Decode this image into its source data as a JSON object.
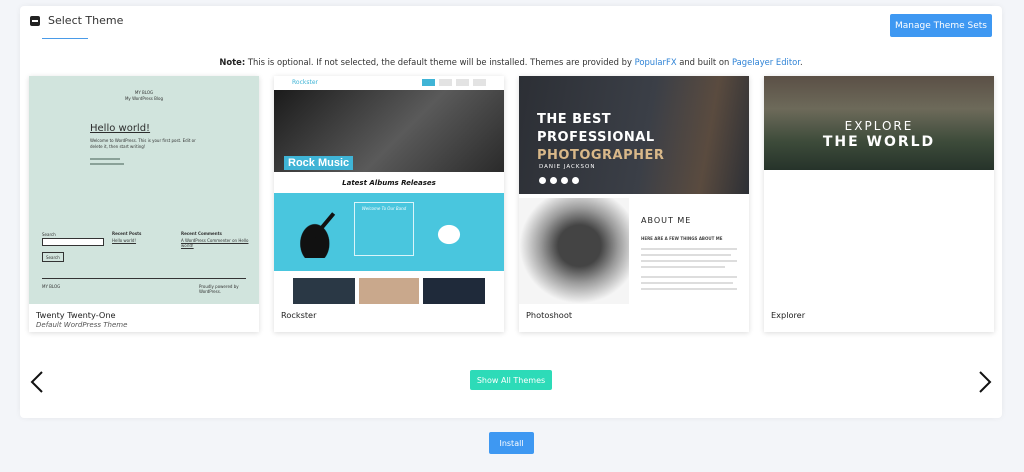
{
  "header": {
    "title": "Select Theme",
    "manage_label": "Manage Theme Sets"
  },
  "note": {
    "label": "Note:",
    "text_before": " This is optional. If not selected, the default theme will be installed. Themes are provided by ",
    "link1": "PopularFX",
    "text_middle": " and built on ",
    "link2": "Pagelayer Editor",
    "text_after": "."
  },
  "themes": [
    {
      "name": "Twenty Twenty-One",
      "subtitle": "Default WordPress Theme",
      "preview": {
        "site_title": "MY BLOG",
        "tagline": "My WordPress Blog",
        "post_title": "Hello world!",
        "post_text": "Welcome to WordPress. This is your first post. Edit or delete it, then start writing!",
        "search_label": "Search",
        "search_button": "Search",
        "recent_posts": "Recent Posts",
        "recent_posts_item": "Hello world!",
        "recent_comments": "Recent Comments",
        "recent_comments_item": "A WordPress Commenter on Hello world!",
        "footer_left": "MY BLOG",
        "footer_right": "Proudly powered by WordPress."
      }
    },
    {
      "name": "Rockster",
      "preview": {
        "brand": "Rockster",
        "hero_label": "Rock Music",
        "section_title": "Latest Albums Releases",
        "welcome": "Welcome To Our Band"
      }
    },
    {
      "name": "Photoshoot",
      "preview": {
        "line1": "THE BEST",
        "line2": "PROFESSIONAL",
        "line3": "PHOTOGRAPHER",
        "name": "DANIE JACKSON",
        "about": "ABOUT ME",
        "about_sub": "HERE ARE A FEW THINGS ABOUT ME"
      }
    },
    {
      "name": "Explorer",
      "preview": {
        "line1": "EXPLORE",
        "line2": "THE WORLD"
      }
    }
  ],
  "nav": {
    "prev_icon": "chevron-left-icon",
    "next_icon": "chevron-right-icon"
  },
  "show_all_label": "Show All Themes",
  "install_label": "Install",
  "colors": {
    "primary": "#3e98f2",
    "accent": "#2ddbb8",
    "link": "#2f83d6"
  }
}
